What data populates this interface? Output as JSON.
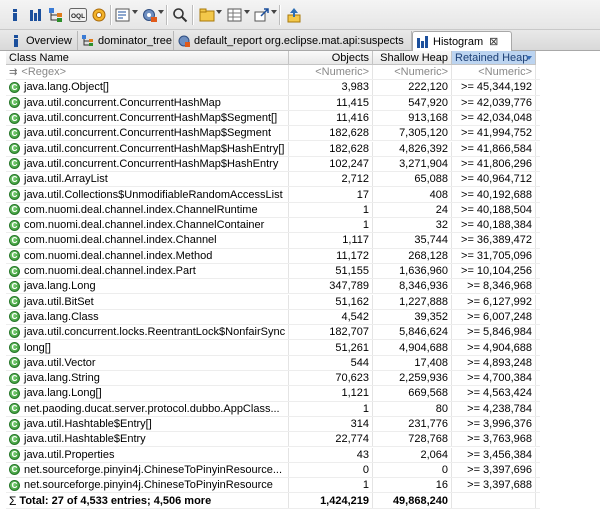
{
  "toolbar": {
    "buttons": [
      {
        "name": "info-icon",
        "glyph": "i"
      },
      {
        "name": "histogram-bar-icon",
        "glyph": "▮"
      },
      {
        "name": "dominator-tree-icon",
        "glyph": "⊞"
      },
      {
        "name": "oql-icon",
        "glyph": "OQL"
      },
      {
        "name": "heap-dump-overview-icon",
        "glyph": "▦"
      },
      {
        "name": "settings-gear-icon",
        "glyph": "⚙"
      },
      {
        "name": "run-report-icon",
        "glyph": "▤"
      },
      {
        "name": "query-browser-icon",
        "glyph": "☰"
      },
      {
        "name": "search-icon",
        "glyph": "⌕"
      },
      {
        "name": "group-by-icon",
        "glyph": "▭"
      },
      {
        "name": "calculate-retained-icon",
        "glyph": "▦"
      },
      {
        "name": "export-icon",
        "glyph": "↗"
      },
      {
        "name": "pin-icon",
        "glyph": "⇪"
      }
    ]
  },
  "tabs": [
    {
      "label": "Overview",
      "active": false
    },
    {
      "label": "dominator_tree",
      "active": false
    },
    {
      "label": "default_report  org.eclipse.mat.api:suspects",
      "active": false
    },
    {
      "label": "Histogram",
      "active": true,
      "close": "⊠"
    }
  ],
  "table": {
    "headers": {
      "class_name": "Class Name",
      "objects": "Objects",
      "shallow": "Shallow Heap",
      "retained": "Retained Heap"
    },
    "filter": {
      "class_name": "<Regex>",
      "objects": "<Numeric>",
      "shallow": "<Numeric>",
      "retained": "<Numeric>"
    },
    "rows": [
      {
        "name": "java.lang.Object[]",
        "objects": "3,983",
        "shallow": "222,120",
        "retained": ">= 45,344,192"
      },
      {
        "name": "java.util.concurrent.ConcurrentHashMap",
        "objects": "11,415",
        "shallow": "547,920",
        "retained": ">= 42,039,776"
      },
      {
        "name": "java.util.concurrent.ConcurrentHashMap$Segment[]",
        "objects": "11,416",
        "shallow": "913,168",
        "retained": ">= 42,034,048"
      },
      {
        "name": "java.util.concurrent.ConcurrentHashMap$Segment",
        "objects": "182,628",
        "shallow": "7,305,120",
        "retained": ">= 41,994,752"
      },
      {
        "name": "java.util.concurrent.ConcurrentHashMap$HashEntry[]",
        "objects": "182,628",
        "shallow": "4,826,392",
        "retained": ">= 41,866,584"
      },
      {
        "name": "java.util.concurrent.ConcurrentHashMap$HashEntry",
        "objects": "102,247",
        "shallow": "3,271,904",
        "retained": ">= 41,806,296"
      },
      {
        "name": "java.util.ArrayList",
        "objects": "2,712",
        "shallow": "65,088",
        "retained": ">= 40,964,712"
      },
      {
        "name": "java.util.Collections$UnmodifiableRandomAccessList",
        "objects": "17",
        "shallow": "408",
        "retained": ">= 40,192,688"
      },
      {
        "name": "com.nuomi.deal.channel.index.ChannelRuntime",
        "objects": "1",
        "shallow": "24",
        "retained": ">= 40,188,504"
      },
      {
        "name": "com.nuomi.deal.channel.index.ChannelContainer",
        "objects": "1",
        "shallow": "32",
        "retained": ">= 40,188,384"
      },
      {
        "name": "com.nuomi.deal.channel.index.Channel",
        "objects": "1,117",
        "shallow": "35,744",
        "retained": ">= 36,389,472"
      },
      {
        "name": "com.nuomi.deal.channel.index.Method",
        "objects": "11,172",
        "shallow": "268,128",
        "retained": ">= 31,705,096"
      },
      {
        "name": "com.nuomi.deal.channel.index.Part",
        "objects": "51,155",
        "shallow": "1,636,960",
        "retained": ">= 10,104,256"
      },
      {
        "name": "java.lang.Long",
        "objects": "347,789",
        "shallow": "8,346,936",
        "retained": ">= 8,346,968"
      },
      {
        "name": "java.util.BitSet",
        "objects": "51,162",
        "shallow": "1,227,888",
        "retained": ">= 6,127,992"
      },
      {
        "name": "java.lang.Class",
        "objects": "4,542",
        "shallow": "39,352",
        "retained": ">= 6,007,248"
      },
      {
        "name": "java.util.concurrent.locks.ReentrantLock$NonfairSync",
        "objects": "182,707",
        "shallow": "5,846,624",
        "retained": ">= 5,846,984"
      },
      {
        "name": "long[]",
        "objects": "51,261",
        "shallow": "4,904,688",
        "retained": ">= 4,904,688"
      },
      {
        "name": "java.util.Vector",
        "objects": "544",
        "shallow": "17,408",
        "retained": ">= 4,893,248"
      },
      {
        "name": "java.lang.String",
        "objects": "70,623",
        "shallow": "2,259,936",
        "retained": ">= 4,700,384"
      },
      {
        "name": "java.lang.Long[]",
        "objects": "1,121",
        "shallow": "669,568",
        "retained": ">= 4,563,424"
      },
      {
        "name": "net.paoding.ducat.server.protocol.dubbo.AppClass...",
        "objects": "1",
        "shallow": "80",
        "retained": ">= 4,238,784"
      },
      {
        "name": "java.util.Hashtable$Entry[]",
        "objects": "314",
        "shallow": "231,776",
        "retained": ">= 3,996,376"
      },
      {
        "name": "java.util.Hashtable$Entry",
        "objects": "22,774",
        "shallow": "728,768",
        "retained": ">= 3,763,968"
      },
      {
        "name": "java.util.Properties",
        "objects": "43",
        "shallow": "2,064",
        "retained": ">= 3,456,384"
      },
      {
        "name": "net.sourceforge.pinyin4j.ChineseToPinyinResource...",
        "objects": "0",
        "shallow": "0",
        "retained": ">= 3,397,696"
      },
      {
        "name": "net.sourceforge.pinyin4j.ChineseToPinyinResource",
        "objects": "1",
        "shallow": "16",
        "retained": ">= 3,397,688"
      }
    ],
    "total": {
      "label": "Total: 27 of 4,533 entries; 4,506 more",
      "objects": "1,424,219",
      "shallow": "49,868,240",
      "retained": ""
    }
  },
  "colors": {
    "class_icon": "#2d8e2a",
    "sorted_header": "#bcd4f0"
  }
}
